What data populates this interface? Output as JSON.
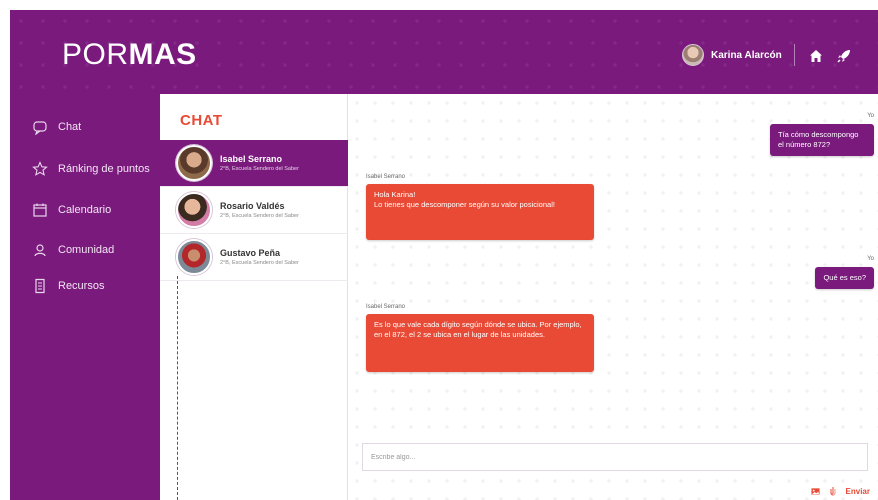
{
  "header": {
    "logo_part1": "POR",
    "logo_part2": "MAS",
    "user_name": "Karina Alarcón",
    "icons": [
      "home-icon",
      "rocket-icon"
    ]
  },
  "sidebar": {
    "items": [
      {
        "label": "Chat",
        "icon": "chat-bubble-icon"
      },
      {
        "label": "Ránking de puntos",
        "icon": "star-icon"
      },
      {
        "label": "Calendario",
        "icon": "calendar-icon"
      },
      {
        "label": "Comunidad",
        "icon": "community-icon"
      },
      {
        "label": "Recursos",
        "icon": "resources-icon"
      }
    ]
  },
  "contacts": {
    "title": "CHAT",
    "list": [
      {
        "name": "Isabel Serrano",
        "subtitle": "2°B, Escuela Sendero del Saber"
      },
      {
        "name": "Rosario Valdés",
        "subtitle": "2°B, Escuela Sendero del Saber"
      },
      {
        "name": "Gustavo Peña",
        "subtitle": "2°B, Escuela Sendero del Saber"
      }
    ]
  },
  "chat": {
    "messages": [
      {
        "sender": "Yo",
        "text": "Tía cómo descompongo el número 872?"
      },
      {
        "sender": "Isabel Serrano",
        "text_line1": "Hola Karina!",
        "text_line2": "Lo tienes que descomponer según su valor posicional!"
      },
      {
        "sender": "Yo",
        "text": "Qué es eso?"
      },
      {
        "sender": "Isabel Serrano",
        "text": "Es lo que vale cada dígito según dónde se ubica. Por ejemplo, en el 872, el 2 se ubica en el lugar de las unidades."
      }
    ],
    "input_placeholder": "Escribe algo...",
    "send_label": "Enviar",
    "input_icons": [
      "image-icon",
      "attachment-icon"
    ]
  },
  "colors": {
    "primary": "#7a1a7d",
    "accent": "#e84a35"
  }
}
